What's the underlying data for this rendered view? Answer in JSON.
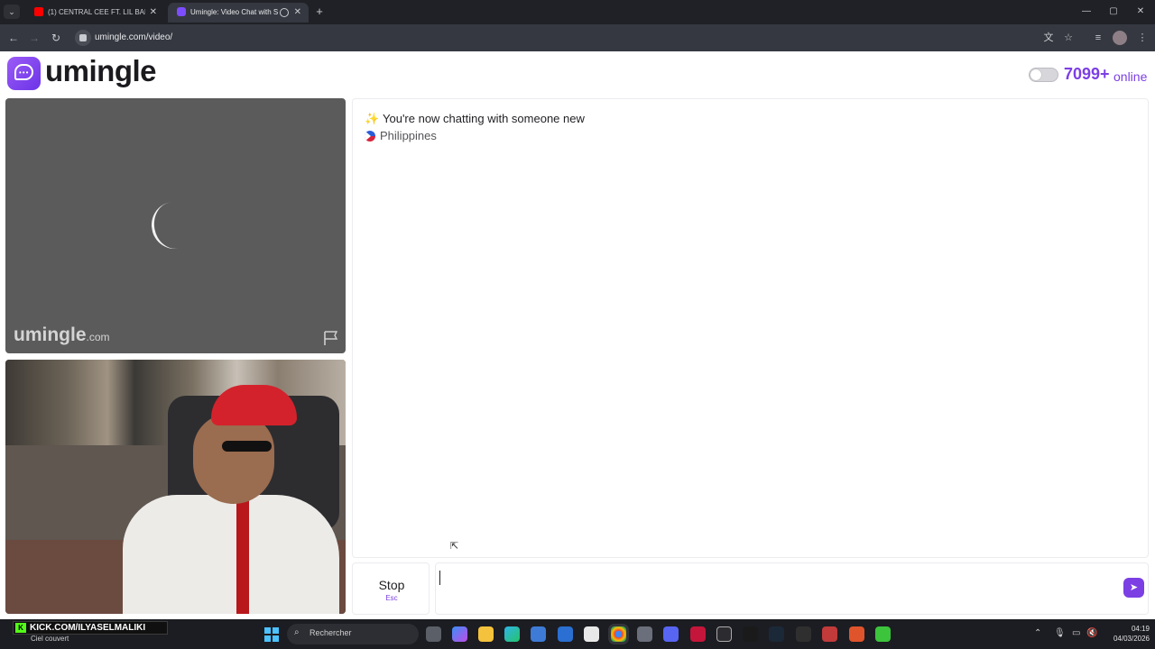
{
  "browser": {
    "tabs": [
      {
        "title": "(1) CENTRAL CEE FT. LIL BABY -",
        "active": false,
        "favicon": "youtube-icon"
      },
      {
        "title": "Umingle: Video Chat with S",
        "active": true,
        "favicon": "umingle-icon"
      }
    ],
    "new_tab_symbol": "+",
    "url": "umingle.com/video/",
    "controls": {
      "minimize": "—",
      "maximize": "▢",
      "close": "✕"
    }
  },
  "site": {
    "logo_text": "umingle",
    "online_count": "7099+",
    "online_label": "online",
    "toggle_on": false,
    "accent_color": "#7b3fe4"
  },
  "remote_video": {
    "watermark_main": "umingle",
    "watermark_suffix": ".com",
    "status": "loading"
  },
  "chat": {
    "connected_message": "You're now chatting with someone new",
    "country": "Philippines",
    "sparkle_icon": "✨"
  },
  "controls": {
    "stop_label": "Stop",
    "stop_key": "Esc",
    "message_value": "",
    "send_icon": "send-icon"
  },
  "taskbar": {
    "overlay_text": "KICK.COM/ILYASELMALIKI",
    "weather": "Ciel couvert",
    "search_label": "Rechercher",
    "time": "04:19",
    "date": "04/03/2026"
  }
}
